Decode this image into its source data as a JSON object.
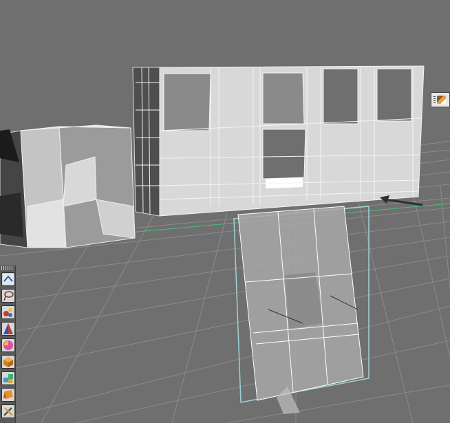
{
  "viewport": {
    "scene": "3d-perspective-view",
    "objects": [
      "building-wall-mesh",
      "cube-mesh",
      "selected-plane-mesh"
    ],
    "colors": {
      "background": "#6f6f6f",
      "grid": "#8a8a8a",
      "horizon_axis": "#4cbf7a",
      "mesh_light": "#dcdcdc",
      "mesh_dark": "#4a4a4a",
      "selection": "#9fd3d3"
    }
  },
  "shelf": {
    "tools": [
      "transform-icon",
      "lasso-icon",
      "paint-icon",
      "cone-icon",
      "color-sphere-icon",
      "cube-icon",
      "cluster-icon",
      "box-icon",
      "tools-icon"
    ]
  },
  "thumbnail": {
    "icon": "material-thumbnail-icon"
  }
}
